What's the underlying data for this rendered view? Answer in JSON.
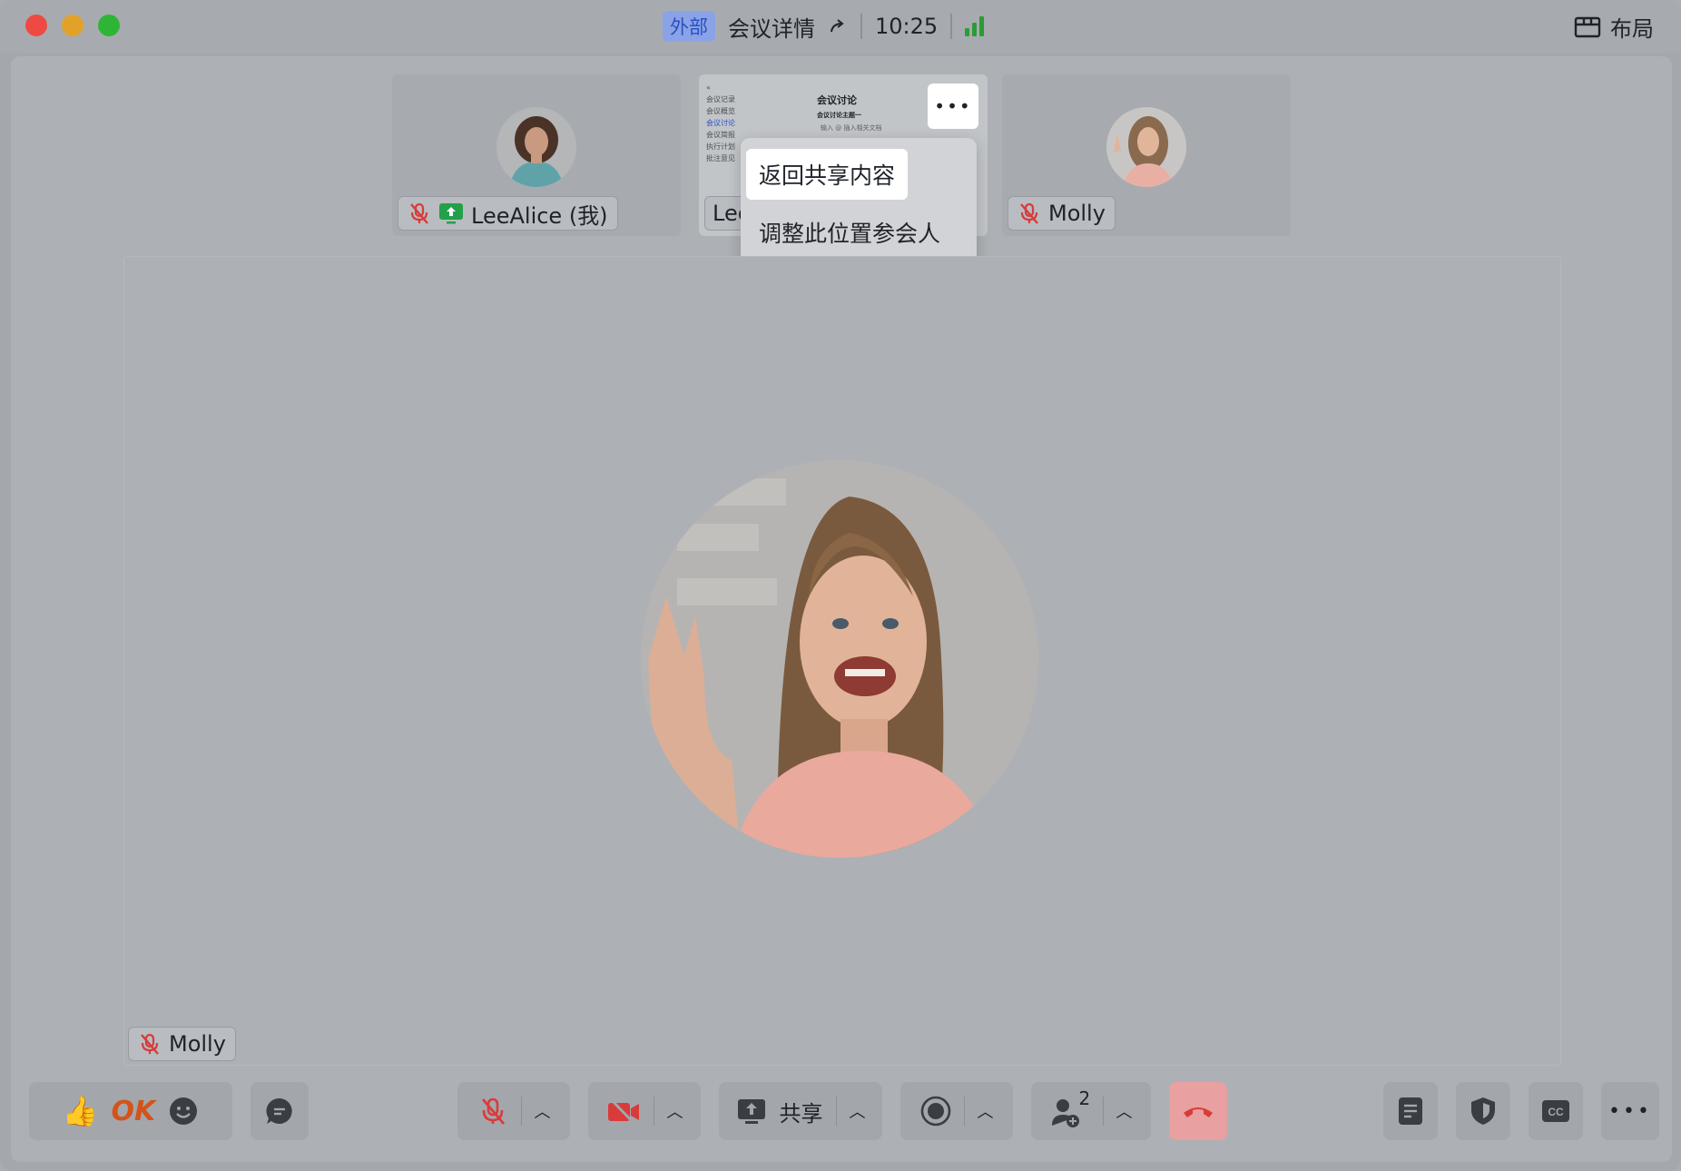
{
  "titlebar": {
    "badge": "外部",
    "meeting_details": "会议详情",
    "time": "10:25",
    "layout_label": "布局"
  },
  "thumbnails": {
    "self_name": "LeeAlice (我)",
    "share_name": "Lee",
    "molly_name": "Molly"
  },
  "share_preview": {
    "nav_items": [
      "会议记录",
      "会议概览",
      "会议讨论",
      "会议简报",
      "执行计划",
      "批注意见"
    ],
    "doc_title": "会议讨论",
    "doc_subtitle": "会议讨论主题一",
    "doc_input": "输入 @ 插入相关文档"
  },
  "popup_menu": {
    "items": [
      "返回共享内容",
      "调整此位置参会人"
    ]
  },
  "main_speaker": {
    "name": "Molly"
  },
  "toolbar": {
    "reaction_ok": "OK",
    "share_label": "共享",
    "participants_count": "2"
  },
  "colors": {
    "accent_blue": "#2a4fc4",
    "mute_red": "#d93b3b",
    "signal_green": "#2b9b36",
    "end_call": "#e8a0a0"
  }
}
